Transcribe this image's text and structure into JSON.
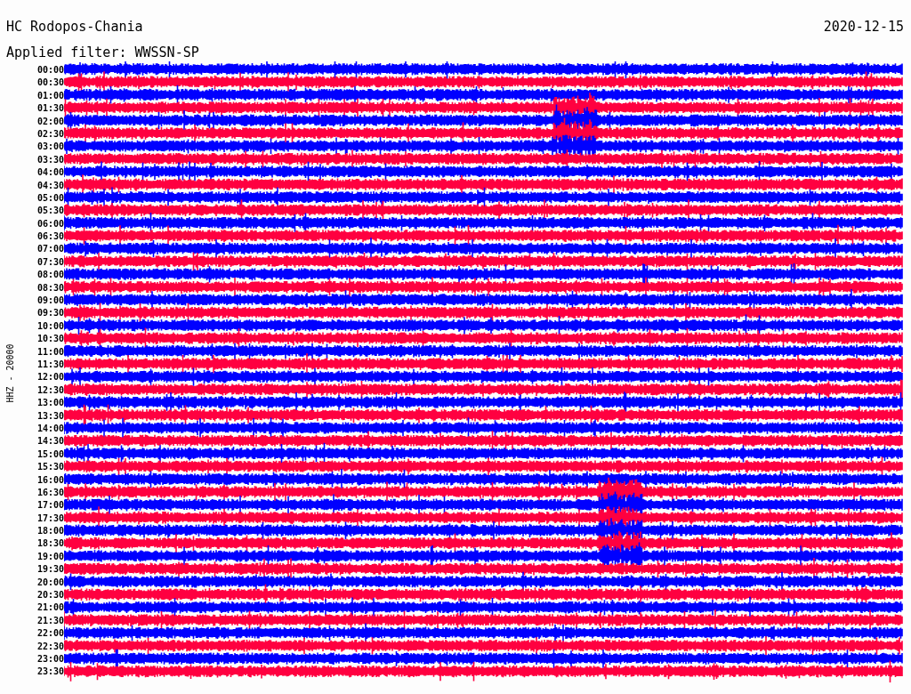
{
  "header": {
    "station": "HC Rodopos-Chania",
    "date": "2020-12-15",
    "filter": "Applied filter: WWSSN-SP"
  },
  "axis_label": "HHZ - 20000",
  "rows": [
    {
      "time": "00:00",
      "color": "#0000ff"
    },
    {
      "time": "00:30",
      "color": "#ff0040"
    },
    {
      "time": "01:00",
      "color": "#0000ff"
    },
    {
      "time": "01:30",
      "color": "#ff0040"
    },
    {
      "time": "02:00",
      "color": "#0000ff"
    },
    {
      "time": "02:30",
      "color": "#ff0040"
    },
    {
      "time": "03:00",
      "color": "#0000ff"
    },
    {
      "time": "03:30",
      "color": "#ff0040"
    },
    {
      "time": "04:00",
      "color": "#0000ff"
    },
    {
      "time": "04:30",
      "color": "#ff0040"
    },
    {
      "time": "05:00",
      "color": "#0000ff"
    },
    {
      "time": "05:30",
      "color": "#ff0040"
    },
    {
      "time": "06:00",
      "color": "#0000ff"
    },
    {
      "time": "06:30",
      "color": "#ff0040"
    },
    {
      "time": "07:00",
      "color": "#0000ff"
    },
    {
      "time": "07:30",
      "color": "#ff0040"
    },
    {
      "time": "08:00",
      "color": "#0000ff"
    },
    {
      "time": "08:30",
      "color": "#ff0040"
    },
    {
      "time": "09:00",
      "color": "#0000ff"
    },
    {
      "time": "09:30",
      "color": "#ff0040"
    },
    {
      "time": "10:00",
      "color": "#0000ff"
    },
    {
      "time": "10:30",
      "color": "#ff0040"
    },
    {
      "time": "11:00",
      "color": "#0000ff"
    },
    {
      "time": "11:30",
      "color": "#ff0040"
    },
    {
      "time": "12:00",
      "color": "#0000ff"
    },
    {
      "time": "12:30",
      "color": "#ff0040"
    },
    {
      "time": "13:00",
      "color": "#0000ff"
    },
    {
      "time": "13:30",
      "color": "#ff0040"
    },
    {
      "time": "14:00",
      "color": "#0000ff"
    },
    {
      "time": "14:30",
      "color": "#ff0040"
    },
    {
      "time": "15:00",
      "color": "#0000ff"
    },
    {
      "time": "15:30",
      "color": "#ff0040"
    },
    {
      "time": "16:00",
      "color": "#0000ff"
    },
    {
      "time": "16:30",
      "color": "#ff0040"
    },
    {
      "time": "17:00",
      "color": "#0000ff"
    },
    {
      "time": "17:30",
      "color": "#ff0040"
    },
    {
      "time": "18:00",
      "color": "#0000ff"
    },
    {
      "time": "18:30",
      "color": "#ff0040"
    },
    {
      "time": "19:00",
      "color": "#0000ff"
    },
    {
      "time": "19:30",
      "color": "#ff0040"
    },
    {
      "time": "20:00",
      "color": "#0000ff"
    },
    {
      "time": "20:30",
      "color": "#ff0040"
    },
    {
      "time": "21:00",
      "color": "#0000ff"
    },
    {
      "time": "21:30",
      "color": "#ff0040"
    },
    {
      "time": "22:00",
      "color": "#0000ff"
    },
    {
      "time": "22:30",
      "color": "#ff0040"
    },
    {
      "time": "23:00",
      "color": "#0000ff"
    },
    {
      "time": "23:30",
      "color": "#ff0040"
    }
  ]
}
